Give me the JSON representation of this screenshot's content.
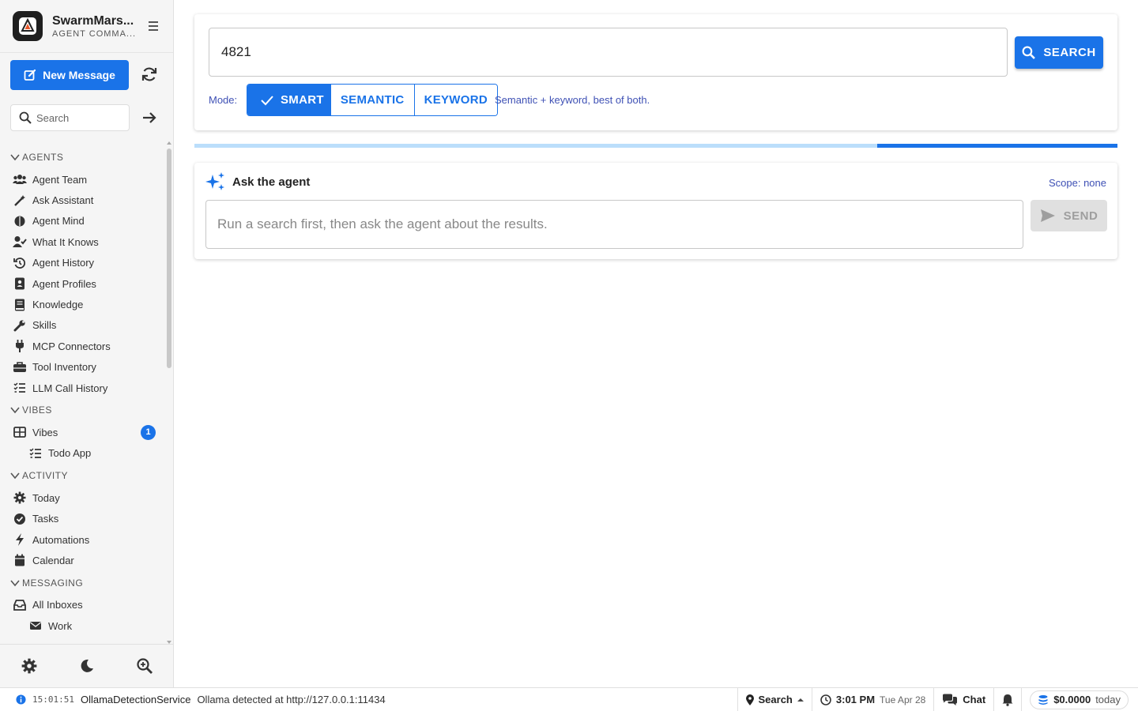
{
  "brand": {
    "title": "SwarmMars...",
    "subtitle": "AGENT COMMA..."
  },
  "sidebar": {
    "new_message_label": "New Message",
    "search_placeholder": "Search",
    "sections": {
      "agents": "AGENTS",
      "vibes": "VIBES",
      "activity": "ACTIVITY",
      "messaging": "MESSAGING"
    },
    "agents": [
      "Agent Team",
      "Ask Assistant",
      "Agent Mind",
      "What It Knows",
      "Agent History",
      "Agent Profiles",
      "Knowledge",
      "Skills",
      "MCP Connectors",
      "Tool Inventory",
      "LLM Call History"
    ],
    "vibes": {
      "label": "Vibes",
      "badge": "1",
      "child": "Todo App"
    },
    "activity": [
      "Today",
      "Tasks",
      "Automations",
      "Calendar"
    ],
    "messaging": {
      "all_inboxes": "All Inboxes",
      "work": "Work"
    }
  },
  "search": {
    "query": "4821",
    "button_label": "SEARCH",
    "mode_label": "Mode:",
    "modes": [
      "SMART",
      "SEMANTIC",
      "KEYWORD"
    ],
    "active_mode": "SMART",
    "mode_hint": "Semantic + keyword, best of both.",
    "progress_fraction": 0.26
  },
  "ask": {
    "title": "Ask the agent",
    "scope": "Scope: none",
    "placeholder": "Run a search first, then ask the agent about the results.",
    "send_label": "SEND"
  },
  "status": {
    "time": "15:01:51",
    "source": "OllamaDetectionService",
    "message": "Ollama detected at http://127.0.0.1:11434",
    "search_label": "Search",
    "clock": "3:01 PM",
    "date": "Tue Apr 28",
    "chat_label": "Chat",
    "cost": "$0.0000",
    "cost_period": "today"
  },
  "colors": {
    "accent": "#1a73e8",
    "indigo_text": "#3f51b5"
  }
}
